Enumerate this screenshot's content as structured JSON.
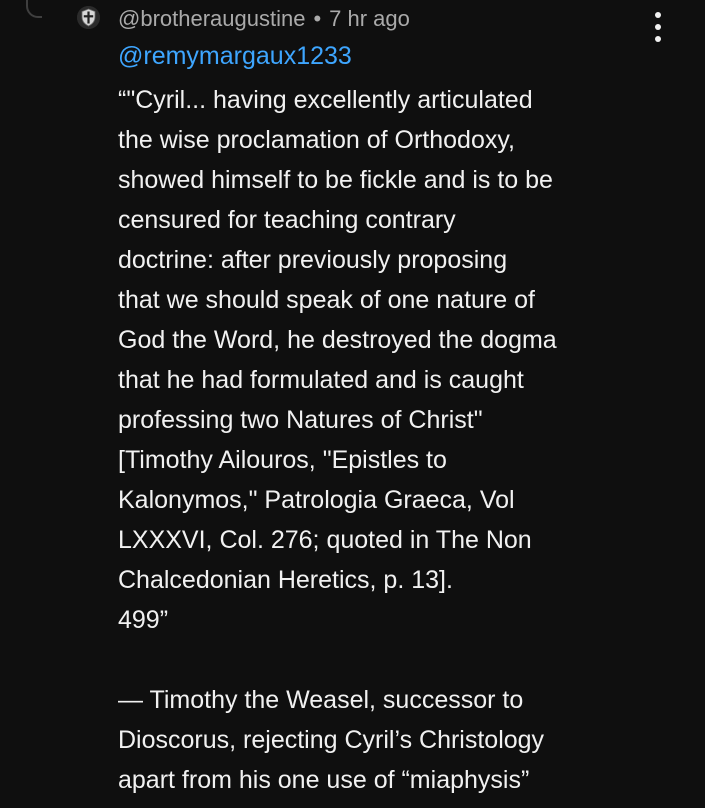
{
  "comment": {
    "author": "@brotheraugustine",
    "separator": "•",
    "time": "7 hr ago",
    "mention": "@remymargaux1233",
    "lines": [
      "“\"Cyril... having excellently articulated",
      "the wise proclamation of Orthodoxy,",
      "showed himself to be fickle and is to be",
      "censured for teaching contrary",
      "doctrine: after previously proposing",
      "that we should speak of one nature of",
      "God the Word, he destroyed the dogma",
      "that he had formulated and is caught",
      "professing two Natures of Christ\"",
      "[Timothy Ailouros, \"Epistles to",
      "Kalonymos,\" Patrologia Graeca, Vol",
      "LXXXVI, Col. 276; quoted in The Non",
      "Chalcedonian Heretics, p. 13].",
      "499”",
      "",
      "— Timothy the Weasel, successor to",
      "Dioscorus, rejecting Cyril’s Christology",
      "apart from his one use of “miaphysis”"
    ]
  },
  "icons": {
    "avatar": "crusader-cross-shield-avatar",
    "menu": "vertical-ellipsis-icon",
    "thread": "reply-thread-line"
  },
  "colors": {
    "background": "#0f0f0f",
    "text": "#f1f1f1",
    "meta": "#aaaaaa",
    "link": "#3ea6ff"
  }
}
